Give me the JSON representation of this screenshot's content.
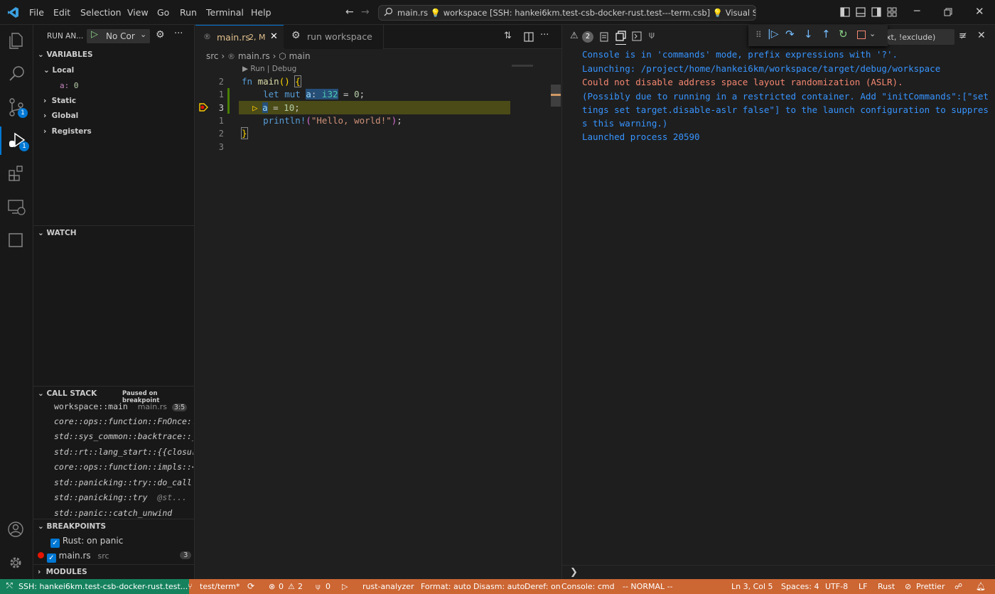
{
  "titlebar": {
    "menu": [
      "File",
      "Edit",
      "Selection",
      "View",
      "Go",
      "Run",
      "Terminal",
      "Help"
    ],
    "command_center": "main.rs 💡 workspace [SSH: hankei6km.test-csb-docker-rust.test---term.csb] 💡 Visual Studio Code"
  },
  "activity": {
    "scm_badge": "1",
    "debug_badge": "1"
  },
  "sidebar": {
    "title": "RUN AN...",
    "config": "No Cor",
    "variables_header": "VARIABLES",
    "local_label": "Local",
    "local_var_name": "a:",
    "local_var_value": "0",
    "static_label": "Static",
    "global_label": "Global",
    "registers_label": "Registers",
    "watch_header": "WATCH",
    "callstack_header": "CALL STACK",
    "callstack_status": "Paused on breakpoint",
    "frames": [
      {
        "name": "workspace::main",
        "file": "main.rs",
        "pos": "3:5"
      },
      {
        "name": "core::ops::function::FnOnce::",
        "file": "",
        "pos": ""
      },
      {
        "name": "std::sys_common::backtrace::_",
        "file": "",
        "pos": ""
      },
      {
        "name": "std::rt::lang_start::{{closur",
        "file": "",
        "pos": ""
      },
      {
        "name": "core::ops::function::impls::<",
        "file": "",
        "pos": ""
      },
      {
        "name": "std::panicking::try::do_call",
        "file": "",
        "pos": ""
      },
      {
        "name": "std::panicking::try",
        "file": "@st...",
        "pos": ""
      },
      {
        "name": "std::panic::catch_unwind",
        "file": "",
        "pos": ""
      }
    ],
    "breakpoints_header": "BREAKPOINTS",
    "bp_rust_panic": "Rust: on panic",
    "bp_file": "main.rs",
    "bp_file_dir": "src",
    "bp_file_count": "3",
    "modules_header": "MODULES"
  },
  "editor": {
    "tab_active": "main.rs",
    "tab_active_status": "2, M",
    "tab_other": "run workspace",
    "breadcrumb_src": "src",
    "breadcrumb_file": "main.rs",
    "breadcrumb_symbol": "main",
    "codelens": "▶ Run | Debug",
    "line_numbers": [
      "2",
      "1",
      "3",
      "1",
      "2",
      "3"
    ],
    "lines": [
      "fn main() {",
      "    let mut a: i32 = 0;",
      "    a = 10;",
      "    println!(\"Hello, world!\");",
      "}",
      ""
    ]
  },
  "panel": {
    "problems_count": "2",
    "filter_placeholder": "xt, !exclude)",
    "console": [
      {
        "text": "Console is in 'commands' mode, prefix expressions with '?'.",
        "color": "#3794ff"
      },
      {
        "text": "Launching: /project/home/hankei6km/workspace/target/debug/workspace",
        "color": "#3794ff"
      },
      {
        "text": "Could not disable address space layout randomization (ASLR).",
        "color": "#f48771"
      },
      {
        "text": "(Possibly due to running in a restricted container. Add \"initCommands\":[\"set",
        "color": "#3794ff"
      },
      {
        "text": "tings set target.disable-aslr false\"] to the launch configuration to suppres",
        "color": "#3794ff"
      },
      {
        "text": "s this warning.)",
        "color": "#3794ff"
      },
      {
        "text": "Launched process 20590",
        "color": "#3794ff"
      }
    ],
    "prompt": "❯"
  },
  "statusbar": {
    "remote": "SSH: hankei6km.test-csb-docker-rust.test...",
    "branch": "test/term*",
    "errors": "0",
    "warnings": "2",
    "ports": "0",
    "analyzer": "rust-analyzer",
    "format": "Format: auto",
    "disasm": "Disasm: auto",
    "deref": "Deref: on",
    "console": "Console: cmd",
    "mode": "-- NORMAL --",
    "position": "Ln 3, Col 5",
    "spaces": "Spaces: 4",
    "encoding": "UTF-8",
    "eol": "LF",
    "language": "Rust",
    "prettier": "Prettier"
  },
  "colors": {
    "statusbar": "#cc6633",
    "accent": "#0078d4",
    "debug_line": "#4b4b18",
    "breakpoint": "#e51400"
  }
}
